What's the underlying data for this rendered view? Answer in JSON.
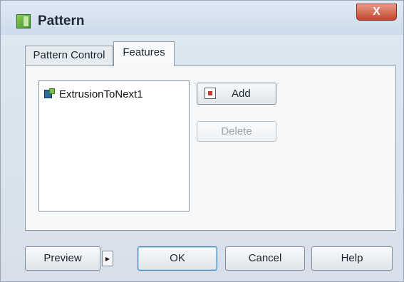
{
  "window": {
    "title": "Pattern",
    "close_label": "X"
  },
  "tabs": [
    {
      "label": "Pattern Control",
      "active": false
    },
    {
      "label": "Features",
      "active": true
    }
  ],
  "features": {
    "items": [
      {
        "label": "ExtrusionToNext1",
        "icon": "extrusion-feature-icon"
      }
    ],
    "add_label": "Add",
    "delete_label": "Delete"
  },
  "buttons": {
    "preview_label": "Preview",
    "preview_arrow": "▸",
    "ok_label": "OK",
    "cancel_label": "Cancel",
    "help_label": "Help"
  }
}
